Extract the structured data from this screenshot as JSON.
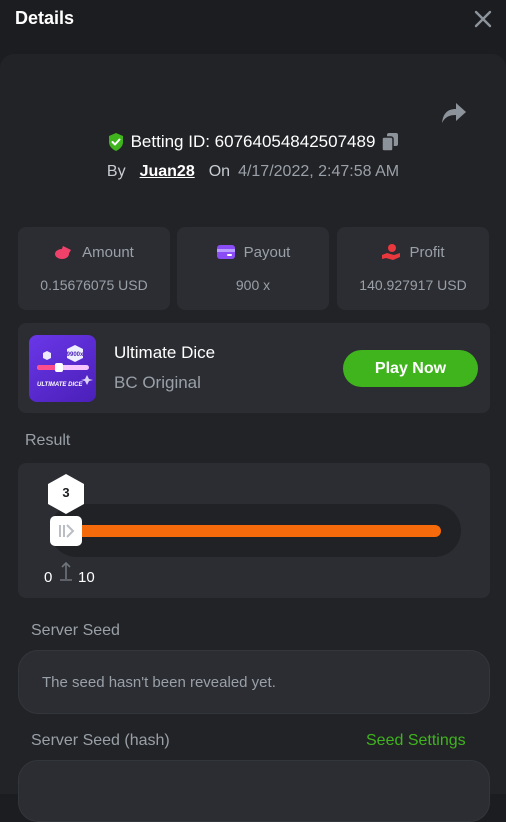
{
  "header": {
    "title": "Details"
  },
  "bet": {
    "id_label": "Betting ID: 60764054842507489",
    "by_label": "By",
    "username": "Juan28",
    "on_label": "On",
    "timestamp": "4/17/2022, 2:47:58 AM"
  },
  "stats": [
    {
      "label": "Amount",
      "value": "0.15676075 USD",
      "icon": "coins-icon",
      "icon_color": "#f0416b"
    },
    {
      "label": "Payout",
      "value": "900 x",
      "icon": "wallet-card-icon",
      "icon_color": "#8a4cf5"
    },
    {
      "label": "Profit",
      "value": "140.927917 USD",
      "icon": "hand-coin-icon",
      "icon_color": "#e8383d"
    }
  ],
  "game": {
    "name": "Ultimate Dice",
    "provider": "BC Original",
    "thumb_title": "ULTIMATE DICE",
    "thumb_badge": "9900x",
    "play_label": "Play Now"
  },
  "result": {
    "label": "Result",
    "value": "3",
    "range_min": "0",
    "range_max": "10"
  },
  "server_seed": {
    "label": "Server Seed",
    "text": "The seed hasn't been revealed yet."
  },
  "server_seed_hash": {
    "label": "Server Seed (hash)",
    "settings_label": "Seed Settings"
  },
  "colors": {
    "accent_green": "#3fb41c",
    "range_orange": "#f56a0a",
    "shield_green": "#3fb41c"
  }
}
